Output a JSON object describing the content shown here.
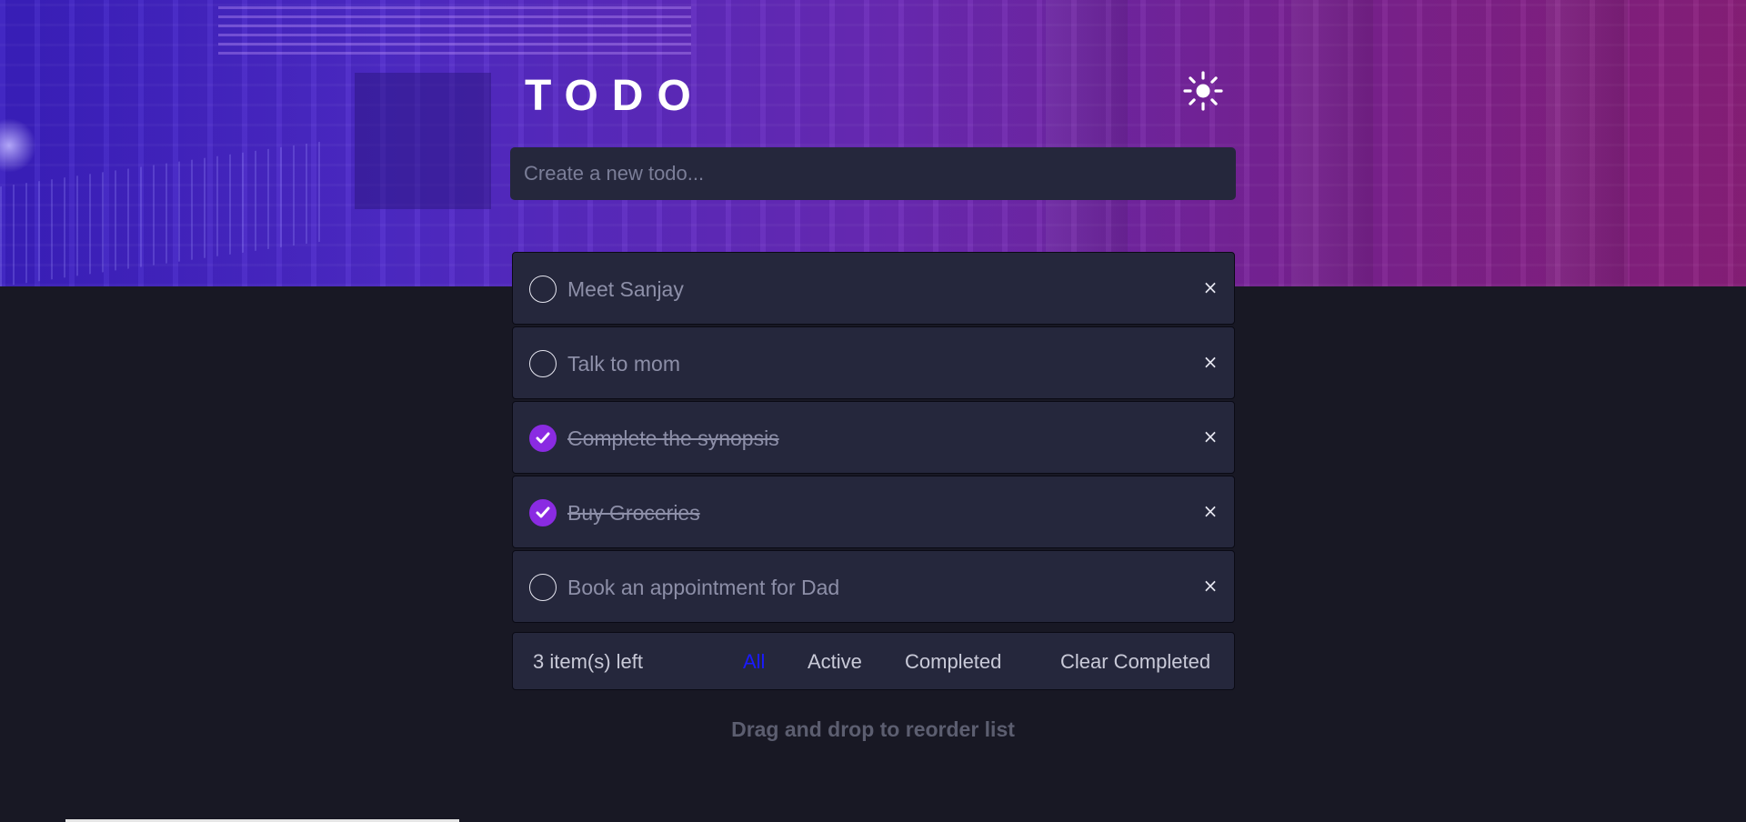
{
  "header": {
    "title": "TODO",
    "theme_icon": "sun-icon"
  },
  "new_todo": {
    "placeholder": "Create a new todo...",
    "value": ""
  },
  "todos": [
    {
      "text": "Meet Sanjay",
      "completed": false
    },
    {
      "text": "Talk to mom",
      "completed": false
    },
    {
      "text": "Complete the synopsis",
      "completed": true
    },
    {
      "text": "Buy Groceries",
      "completed": true
    },
    {
      "text": "Book an appointment for Dad",
      "completed": false
    }
  ],
  "delete_glyph": "×",
  "footer": {
    "items_left": "3 item(s) left",
    "filters": [
      "All",
      "Active",
      "Completed"
    ],
    "active_filter": "All",
    "clear_label": "Clear Completed"
  },
  "hint": "Drag and drop to reorder list",
  "colors": {
    "background": "#181824",
    "card": "#25273c",
    "accent": "#8a2be2",
    "active_filter": "#1a1aff"
  }
}
